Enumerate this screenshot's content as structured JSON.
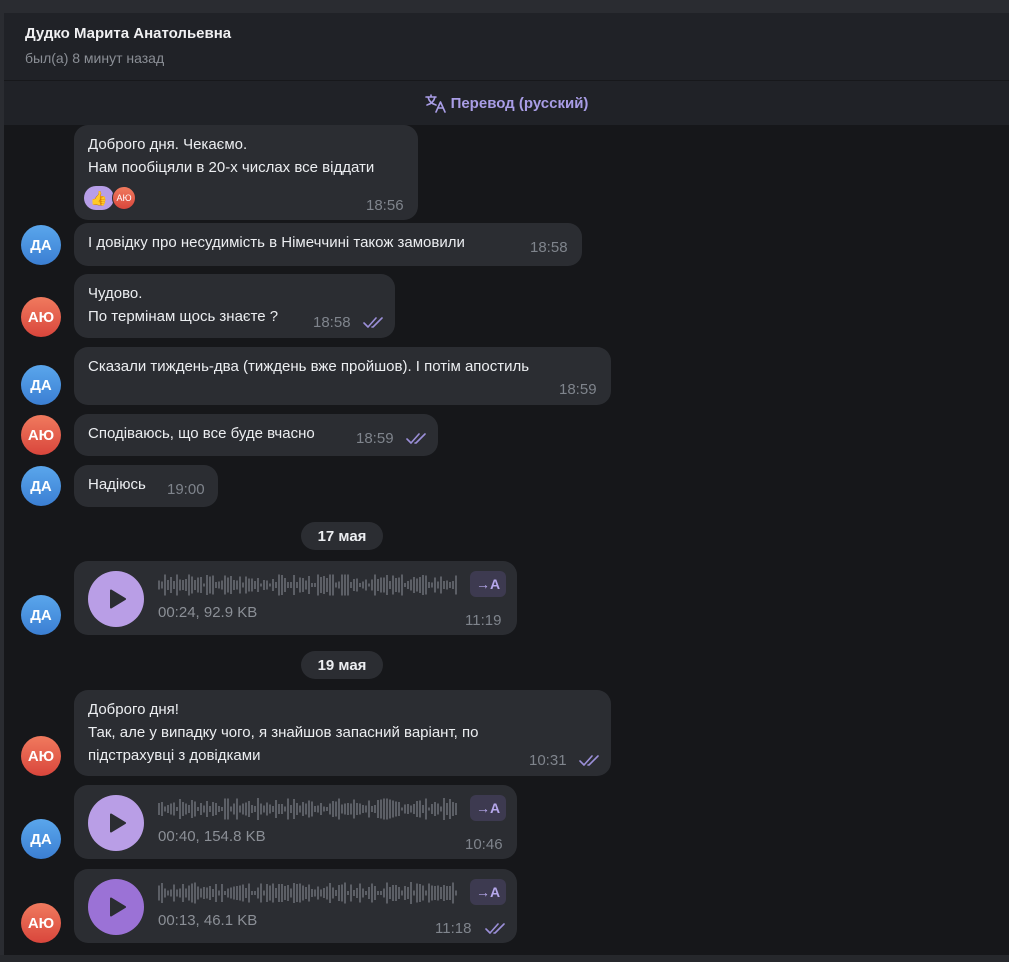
{
  "header": {
    "name": "Дудко Марита Анатольевна",
    "status": "был(а) 8 минут назад"
  },
  "translate_bar": {
    "label": "Перевод (русский)",
    "icon": "translate-icon",
    "color": "#a99de6"
  },
  "colors": {
    "accent": "#a99de6",
    "bubble": "#2b2d32",
    "background": "#16171a",
    "avatar_da": "#4a90e2",
    "avatar_ay": "#e5594a"
  },
  "messages": [
    {
      "sender": "",
      "lines": [
        "Доброго дня. Чекаємо.",
        "Нам пообіцяли в 20-х числах все віддати"
      ],
      "time": "18:56",
      "reactions": {
        "emoji": "👍",
        "avatar": "АЮ"
      }
    },
    {
      "sender": "ДА",
      "lines": [
        "І довідку про несудимість в Німеччині також замовили"
      ],
      "time": "18:58"
    },
    {
      "sender": "АЮ",
      "lines": [
        "Чудово.",
        "По термінам щось знаєте ?"
      ],
      "time": "18:58",
      "read": true
    },
    {
      "sender": "ДА",
      "lines": [
        "Сказали тиждень-два (тиждень вже пройшов). І потім апостиль"
      ],
      "time": "18:59"
    },
    {
      "sender": "АЮ",
      "lines": [
        "Сподіваюсь, що все буде вчасно"
      ],
      "time": "18:59",
      "read": true
    },
    {
      "sender": "ДА",
      "lines": [
        "Надіюсь"
      ],
      "time": "19:00"
    },
    {
      "date": "17 мая"
    },
    {
      "sender": "ДА",
      "voice": {
        "meta": "00:24, 92.9 KB",
        "translate": "→A"
      },
      "time": "11:19"
    },
    {
      "date": "19 мая"
    },
    {
      "sender": "АЮ",
      "lines": [
        "Доброго дня!",
        "Так, але у випадку чого, я знайшов запасний варіант, по",
        "підстрахувці з довідками"
      ],
      "time": "10:31",
      "read": true
    },
    {
      "sender": "ДА",
      "voice": {
        "meta": "00:40, 154.8 KB",
        "translate": "→A"
      },
      "time": "10:46"
    },
    {
      "sender": "АЮ",
      "voice": {
        "meta": "00:13, 46.1 KB",
        "translate": "→A"
      },
      "time": "11:18",
      "read": true
    }
  ]
}
